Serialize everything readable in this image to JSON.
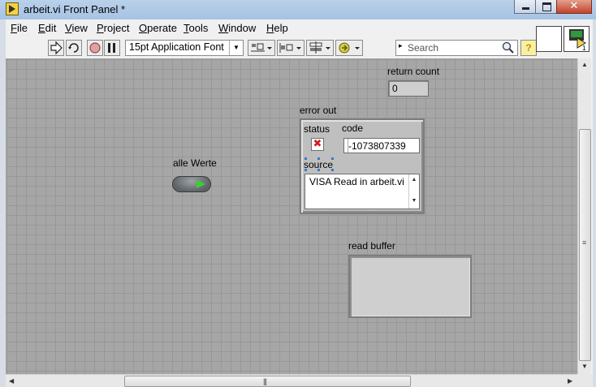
{
  "window": {
    "title": "arbeit.vi Front Panel *",
    "close_glyph": "✕"
  },
  "menu": [
    {
      "label": "File",
      "mnemonic": "F",
      "rest": "ile"
    },
    {
      "label": "Edit",
      "mnemonic": "E",
      "rest": "dit"
    },
    {
      "label": "View",
      "mnemonic": "V",
      "rest": "iew"
    },
    {
      "label": "Project",
      "mnemonic": "P",
      "rest": "roject"
    },
    {
      "label": "Operate",
      "mnemonic": "O",
      "rest": "perate"
    },
    {
      "label": "Tools",
      "mnemonic": "T",
      "rest": "ools"
    },
    {
      "label": "Window",
      "mnemonic": "W",
      "rest": "indow"
    },
    {
      "label": "Help",
      "mnemonic": "H",
      "rest": "elp"
    }
  ],
  "toolbar": {
    "font": "15pt Application Font",
    "search_placeholder": "Search",
    "help_glyph": "?",
    "icons": [
      "run-arrow-icon",
      "run-continuously-icon",
      "abort-icon",
      "pause-icon",
      "align-objects-icon",
      "distribute-objects-icon",
      "resize-objects-icon",
      "reorder-icon"
    ]
  },
  "panel": {
    "return_count": {
      "label": "return count",
      "value": "0"
    },
    "error_out": {
      "label": "error out",
      "status_label": "status",
      "status_glyph": "✖",
      "code_label": "code",
      "code_value": "-1073807339",
      "source_label": "source",
      "source_value": "VISA Read in arbeit.vi"
    },
    "alle_werte": {
      "label": "alle Werte"
    },
    "read_buffer": {
      "label": "read buffer",
      "value": ""
    }
  },
  "scrollbars": {
    "grip": "|||",
    "vgrip": "≡"
  },
  "colors": {
    "panel_grid": "#a6a6a6",
    "led_on": "#35d42a",
    "status_error": "#d21e1e"
  }
}
